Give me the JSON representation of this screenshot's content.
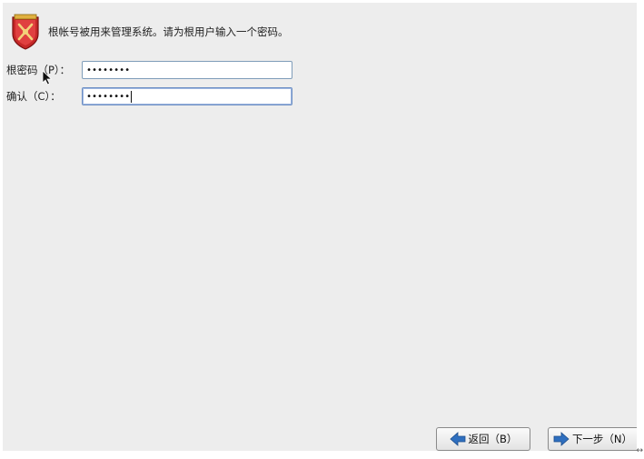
{
  "header": {
    "message": "根帐号被用来管理系统。请为根用户输入一个密码。",
    "icon": "shield-emblem-icon"
  },
  "form": {
    "password_label": "根密码（P）：",
    "password_value": "••••••••",
    "confirm_label": "确认（C）：",
    "confirm_value": "••••••••"
  },
  "buttons": {
    "back_label": "返回（B）",
    "next_label": "下一步（N）"
  },
  "colors": {
    "shield_red": "#c62828",
    "shield_gold": "#e0b040",
    "arrow_blue": "#2f6fbf"
  }
}
